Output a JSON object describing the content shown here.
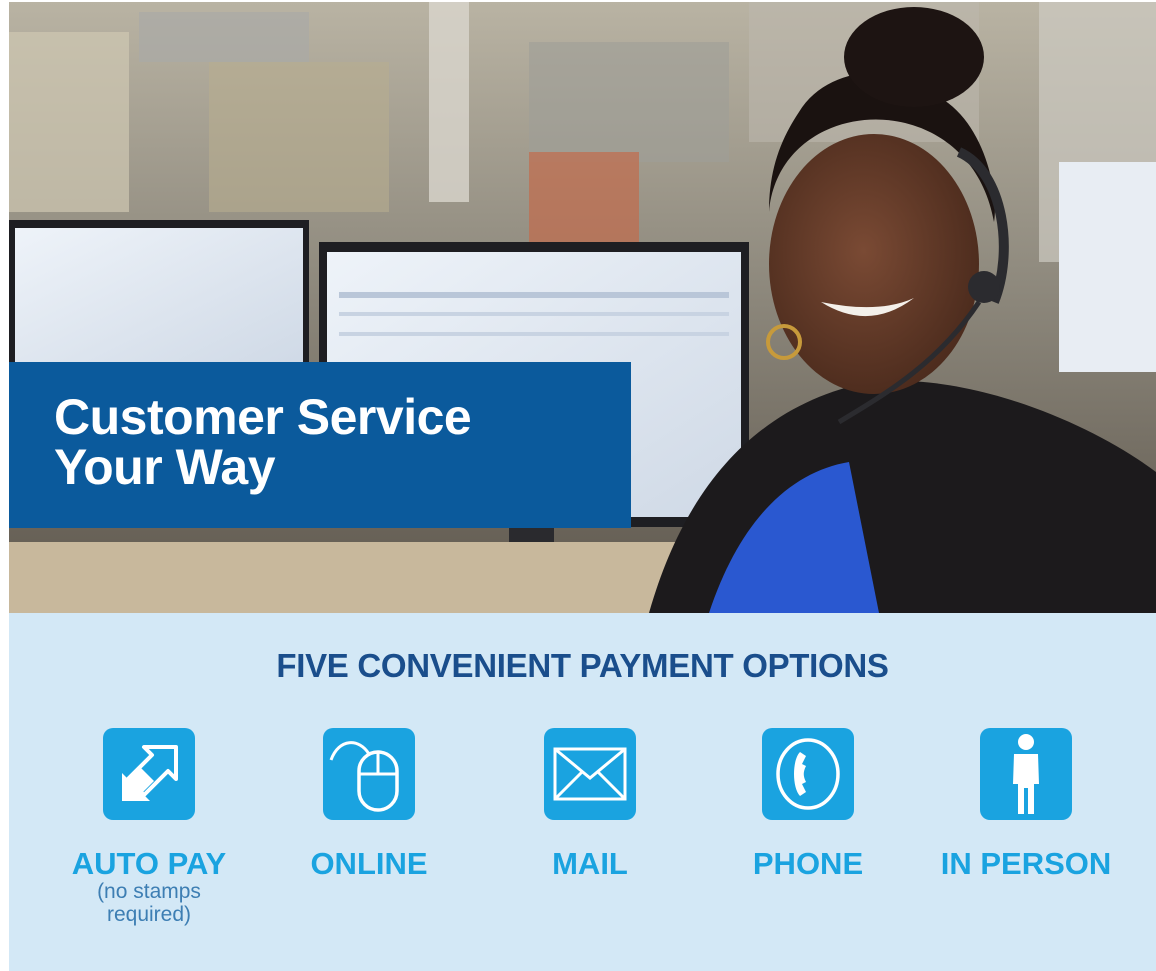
{
  "hero": {
    "headline_line1": "Customer Service",
    "headline_line2": "Your Way"
  },
  "options": {
    "title": "FIVE CONVENIENT PAYMENT OPTIONS",
    "items": [
      {
        "label": "AUTO PAY",
        "note": "(no stamps required)",
        "icon": "auto-pay-arrows-icon"
      },
      {
        "label": "ONLINE",
        "icon": "computer-mouse-icon"
      },
      {
        "label": "MAIL",
        "icon": "envelope-icon"
      },
      {
        "label": "PHONE",
        "icon": "phone-icon"
      },
      {
        "label": "IN PERSON",
        "icon": "person-icon"
      }
    ]
  },
  "colors": {
    "headline_box": "#0b5a9c",
    "panel_background": "#d3e8f6",
    "title_text": "#1a4e8c",
    "accent": "#1aa3e0"
  }
}
